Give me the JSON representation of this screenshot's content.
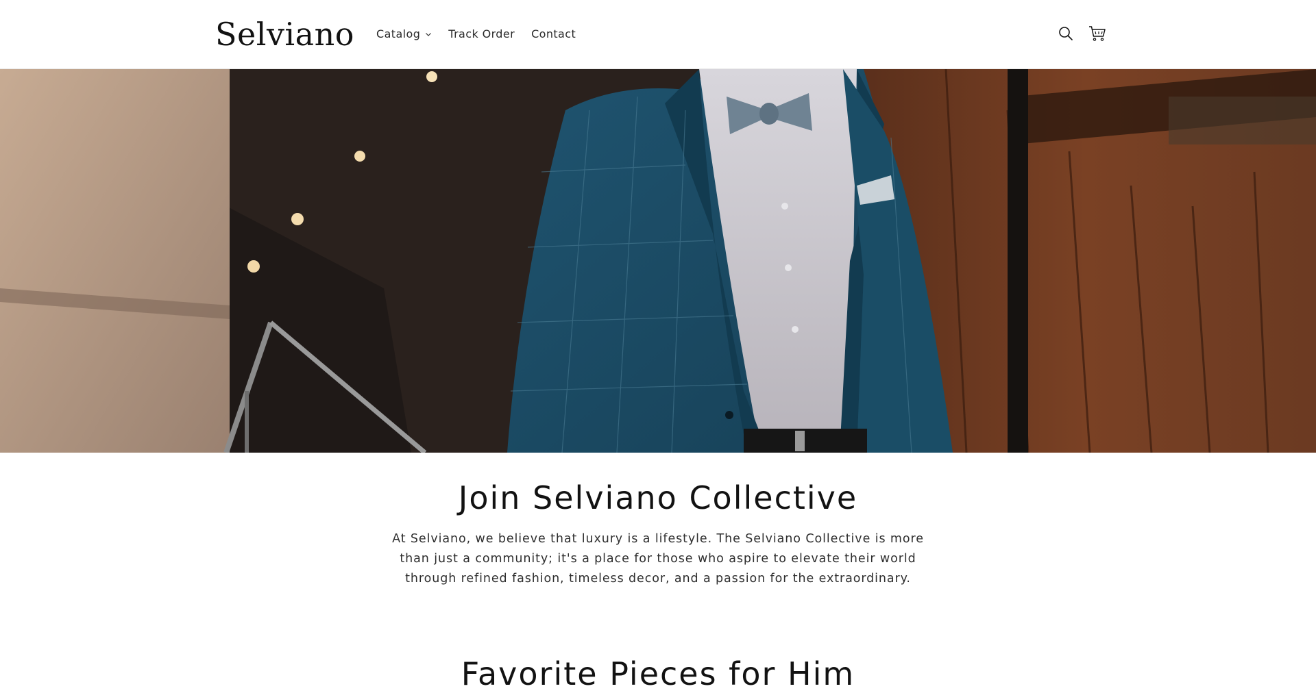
{
  "header": {
    "logo": "Selviano",
    "nav": [
      {
        "label": "Catalog",
        "has_dropdown": true
      },
      {
        "label": "Track Order"
      },
      {
        "label": "Contact"
      }
    ],
    "icons": [
      "search-icon",
      "cart-icon"
    ]
  },
  "hero": {
    "image": "man-in-blue-checked-suit-with-bow-tie"
  },
  "collective": {
    "title": "Join Selviano Collective",
    "body": "At Selviano, we believe that luxury is a lifestyle. The Selviano Collective is more than just a community; it's a place for those who aspire to elevate their world through refined fashion, timeless decor, and a passion for the extraordinary."
  },
  "favorites": {
    "title": "Favorite Pieces for Him"
  }
}
